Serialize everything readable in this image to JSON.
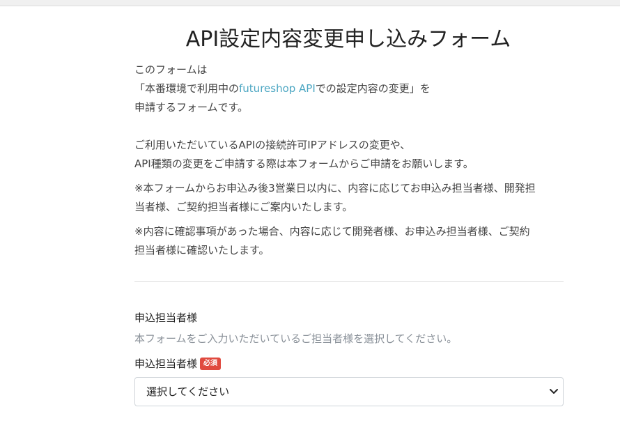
{
  "page": {
    "title": "API設定内容変更申し込みフォーム"
  },
  "intro": {
    "line1": "このフォームは",
    "line2_prefix": "「本番環境で利用中の",
    "line2_link": "futureshop API",
    "line2_suffix": "での設定内容の変更」を",
    "line3": "申請するフォームです。",
    "line5": "ご利用いただいているAPIの接続許可IPアドレスの変更や、",
    "line6": "API種類の変更をご申請する際は本フォームからご申請をお願いします。"
  },
  "notes": {
    "note1_line1": "※本フォームからお申込み後3営業日以内に、内容に応じてお申込み担当者様、開発担",
    "note1_line2": "当者様、ご契約担当者様にご案内いたします。",
    "note2_line1": "※内容に確認事項があった場合、内容に応じて開発者様、お申込み担当者様、ご契約",
    "note2_line2": "担当者様に確認いたします。"
  },
  "section": {
    "heading": "申込担当者様",
    "description": "本フォームをご入力いただいているご担当者様を選択してください。"
  },
  "field": {
    "label": "申込担当者様",
    "required_badge": "必須",
    "select_value": "選択してください"
  },
  "colors": {
    "link": "#4ba6c2",
    "required_badge": "#e04a3f",
    "muted_text": "#8a9199"
  }
}
